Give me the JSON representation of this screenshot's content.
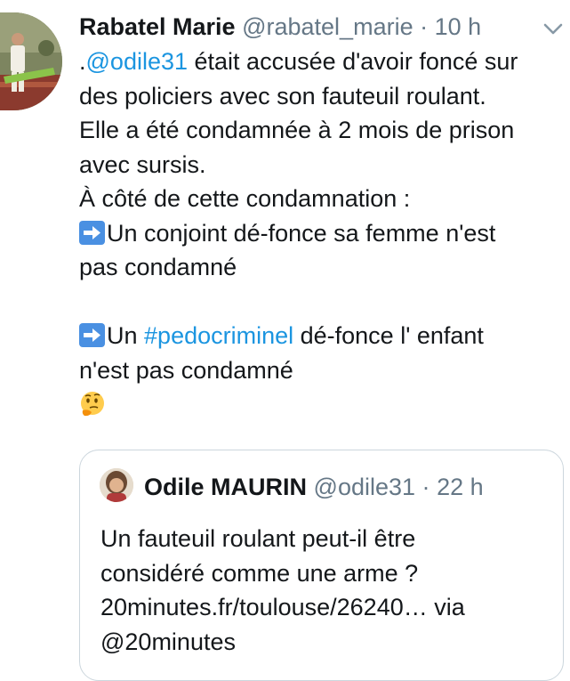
{
  "tweet": {
    "author_name": "Rabatel Marie",
    "author_handle": "@rabatel_marie",
    "separator": "·",
    "time": "10 h",
    "avatar_icon": "profile-photo",
    "menu_icon": "chevron-down-icon",
    "lines": {
      "l1_prefix": ".",
      "l1_mention": "@odile31",
      "l1_rest": " était accusée d'avoir foncé sur",
      "l2": "des policiers avec son fauteuil roulant.",
      "l3": "Elle a été condamnée à 2 mois de prison",
      "l4": "avec sursis.",
      "l5": "À côté de cette condamnation :",
      "l6": "Un conjoint dé-fonce sa femme n'est",
      "l7": "pas condamné",
      "l8_prefix": "Un ",
      "l8_hashtag": "#pedocriminel",
      "l8_rest": " dé-fonce l' enfant",
      "l9": "n'est pas condamné"
    },
    "emojis": {
      "arrow": "right-arrow-emoji",
      "thinking": "thinking-face-emoji"
    },
    "colors": {
      "link": "#1b95e0",
      "secondary": "#657786",
      "text": "#14171a",
      "border": "#ccd6dd"
    }
  },
  "quoted_tweet": {
    "author_name": "Odile MAURIN",
    "author_handle": "@odile31",
    "separator": "·",
    "time": "22 h",
    "lines": {
      "l1": "Un fauteuil roulant peut-il être",
      "l2": "considéré comme une arme ?",
      "l3": "20minutes.fr/toulouse/26240… via",
      "l4": "@20minutes"
    }
  }
}
